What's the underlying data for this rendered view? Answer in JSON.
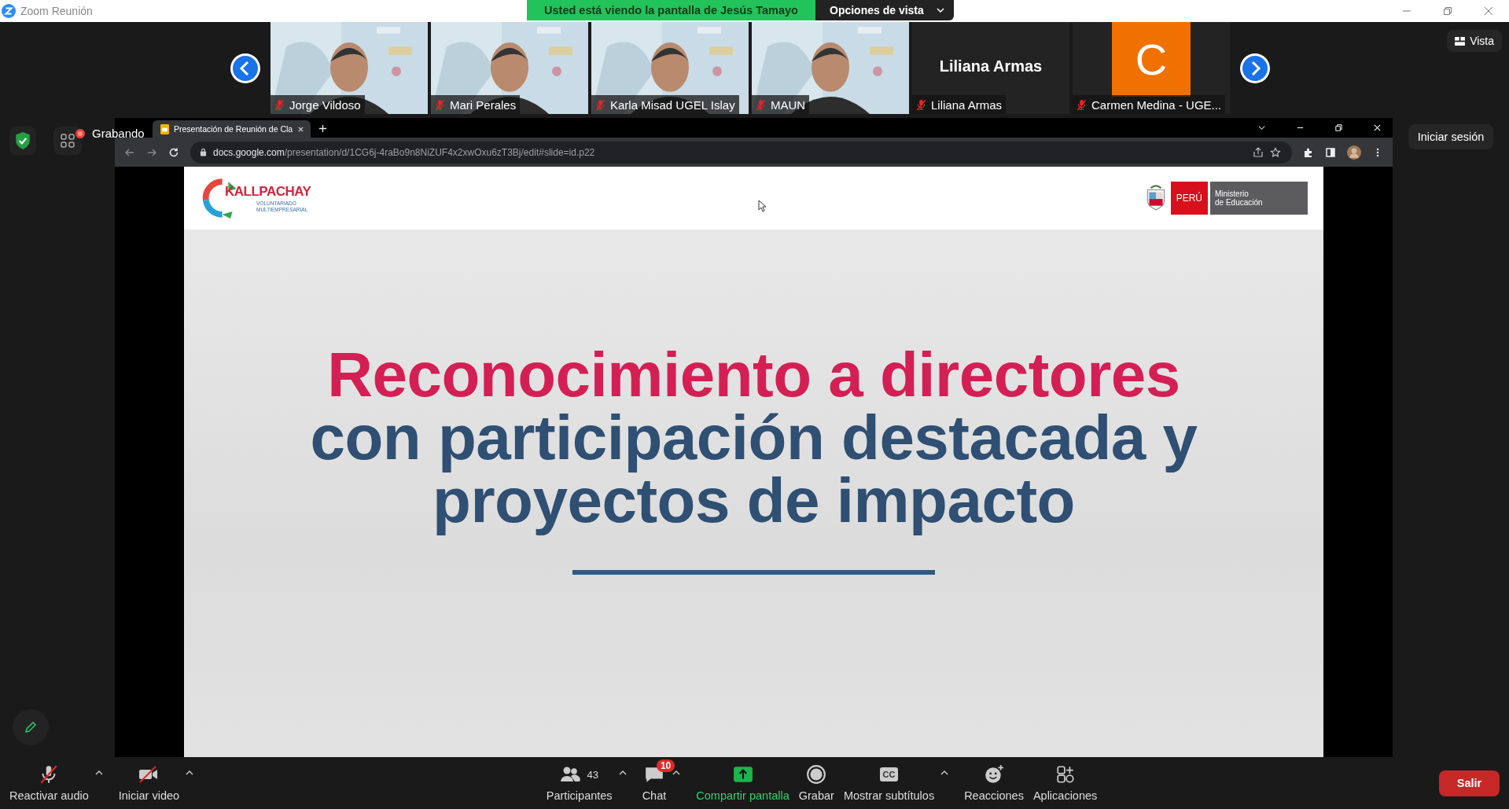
{
  "window": {
    "title": "Zoom Reunión"
  },
  "share_banner": {
    "text": "Usted está viendo la pantalla de Jesús Tamayo",
    "view_options": "Opciones de vista"
  },
  "participants": [
    {
      "name": "Jorge Vildoso",
      "kind": "video",
      "muted": true
    },
    {
      "name": "Mari Perales",
      "kind": "video",
      "muted": true
    },
    {
      "name": "Karla Misad UGEL Islay",
      "kind": "video",
      "muted": true
    },
    {
      "name": "MAUN",
      "kind": "video",
      "muted": true
    },
    {
      "name": "Liliana Armas",
      "kind": "name",
      "display_name": "Liliana Armas",
      "muted": true
    },
    {
      "name": "Carmen Medina - UGE...",
      "kind": "avatar",
      "initial": "C",
      "muted": true
    }
  ],
  "view_button": "Vista",
  "recording": {
    "label": "Grabando"
  },
  "sign_in": "Iniciar sesión",
  "browser": {
    "tab_title": "Presentación de Reunión de Cla",
    "url_host": "docs.google.com",
    "url_path": "/presentation/d/1CG6j-4raBo9n8NiZUF4x2xwOxu6zT3Bj/edit#slide=id.p22"
  },
  "slide": {
    "brand": "KALLPACHAY",
    "brand_sub": [
      "VOLUNTARIADO",
      "MULTIEMPRESARIAL"
    ],
    "country": "PERÚ",
    "ministry": [
      "Ministerio",
      "de Educación"
    ],
    "title_lines": [
      {
        "text": "Reconocimiento a directores",
        "kind": "accent"
      },
      {
        "text": "con participación destacada y",
        "kind": "main"
      },
      {
        "text": "proyectos de impacto",
        "kind": "main"
      }
    ]
  },
  "toolbar": [
    {
      "label": "Reactivar audio",
      "kind": "mic",
      "off": true,
      "menu": true
    },
    {
      "label": "Iniciar video",
      "kind": "camera",
      "off": true,
      "menu": true
    },
    {
      "label": "Participantes",
      "kind": "people",
      "count": "43",
      "menu": true
    },
    {
      "label": "Chat",
      "kind": "chat",
      "badge": "10",
      "menu": true
    },
    {
      "label": "Compartir pantalla",
      "kind": "share",
      "menu": false
    },
    {
      "label": "Grabar",
      "kind": "record",
      "menu": false
    },
    {
      "label": "Mostrar subtítulos",
      "kind": "cc",
      "icon_text": "CC",
      "menu": true
    },
    {
      "label": "Reacciones",
      "kind": "react",
      "menu": false
    },
    {
      "label": "Aplicaciones",
      "kind": "apps",
      "menu": false
    }
  ],
  "leave_button": "Salir"
}
